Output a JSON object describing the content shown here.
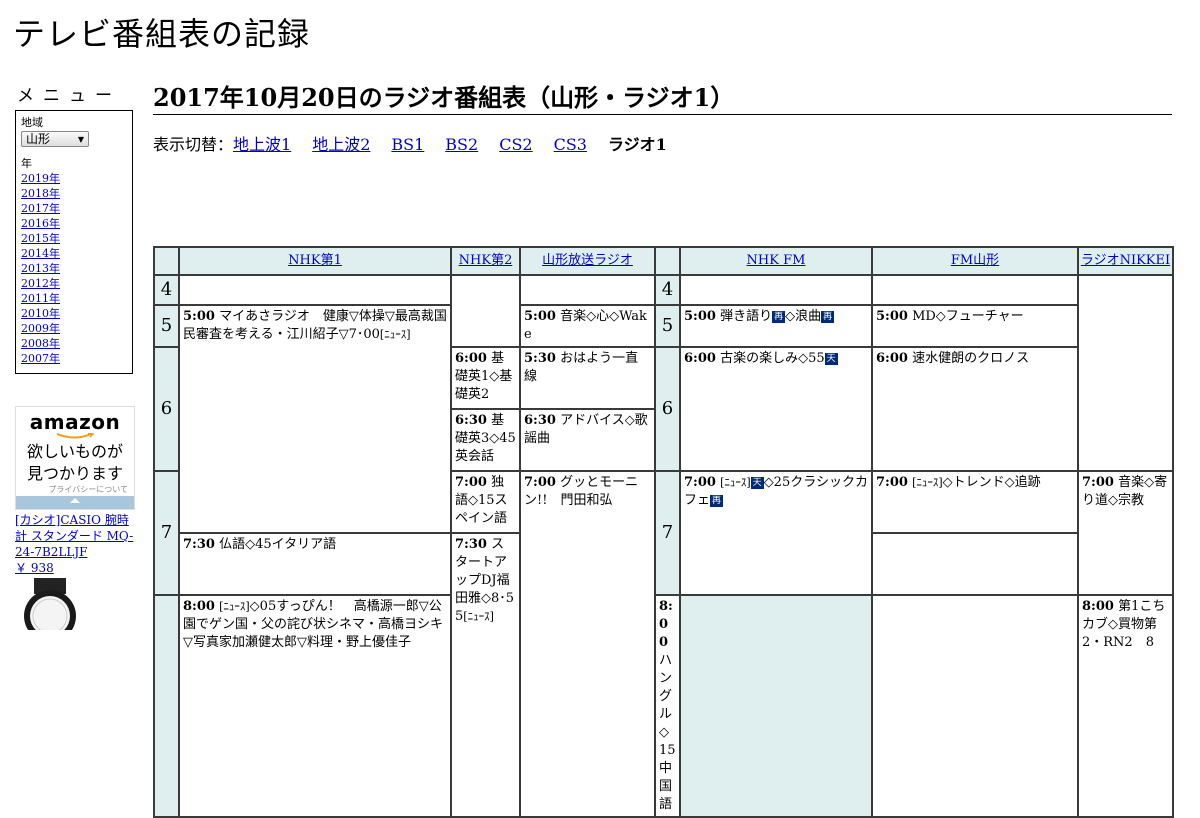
{
  "site": {
    "title": "テレビ番組表の記録"
  },
  "sidebar": {
    "heading": "メニュー",
    "region_label": "地域",
    "region_value": "山形",
    "year_label": "年",
    "years": [
      "2019年",
      "2018年",
      "2017年",
      "2016年",
      "2015年",
      "2014年",
      "2013年",
      "2012年",
      "2011年",
      "2010年",
      "2009年",
      "2008年",
      "2007年"
    ]
  },
  "ad": {
    "logo": "amazon",
    "line1": "欲しいものが",
    "line2": "見つかります",
    "privacy": "プライバシーについて",
    "product_title": "[カシオ]CASIO 腕時計 スタンダード MQ-24-7B2LLJF",
    "price": "￥ 938"
  },
  "page": {
    "heading": "2017年10月20日のラジオ番組表（山形・ラジオ1）",
    "switch_label": "表示切替：",
    "switch_links": [
      "地上波1",
      "地上波2",
      "BS1",
      "BS2",
      "CS2",
      "CS3"
    ],
    "switch_current": "ラジオ1"
  },
  "grid": {
    "stations": [
      "NHK第1",
      "NHK第2",
      "山形放送ラジオ",
      "NHK FM",
      "FM山形",
      "ラジオNIKKEI"
    ],
    "hours": [
      "4",
      "5",
      "6",
      "7"
    ],
    "programs": {
      "nhk1_500": {
        "time": "5:00",
        "title": "マイあさラジオ　健康▽体操▽最高裁国民審査を考える・江川紹子▽7･00",
        "mark": "[ﾆｭｰｽ]"
      },
      "nhk1_800": {
        "time": "8:00",
        "mark": "[ﾆｭｰｽ]",
        "title": "◇05すっぴん！　高橋源一郎▽公園でゲン国・父の詫び状シネマ・高橋ヨシキ▽写真家加瀬健太郎▽料理・野上優佳子"
      },
      "nhk2_600": {
        "time": "6:00",
        "title": "基礎英1◇基礎英2"
      },
      "nhk2_630": {
        "time": "6:30",
        "title": "基礎英3◇45英会話"
      },
      "nhk2_700": {
        "time": "7:00",
        "title": "独語◇15スペイン語"
      },
      "nhk2_730": {
        "time": "7:30",
        "title": "仏語◇45イタリア語"
      },
      "nhk2_800": {
        "time": "8:00",
        "title": "ハングル◇15中国語"
      },
      "ybc_500": {
        "time": "5:00",
        "title": "音楽◇心◇Wake"
      },
      "ybc_530": {
        "time": "5:30",
        "title": "おはよう一直線"
      },
      "ybc_630": {
        "time": "6:30",
        "title": "アドバイス◇歌謡曲"
      },
      "ybc_700": {
        "time": "7:00",
        "title": "グッとモーニン!!　門田和弘"
      },
      "nhkfm_500": {
        "time": "5:00",
        "title": "弾き語り",
        "mark1": "再",
        "title2": "◇浪曲",
        "mark2": "再"
      },
      "nhkfm_600": {
        "time": "6:00",
        "title": "古楽の楽しみ◇55",
        "mark": "天"
      },
      "nhkfm_700": {
        "time": "7:00",
        "mark1": "[ﾆｭｰｽ]",
        "mark2": "天",
        "title": "◇25クラシックカフェ",
        "mark3": "再"
      },
      "fmy_500": {
        "time": "5:00",
        "title": "MD◇フューチャー"
      },
      "fmy_600": {
        "time": "6:00",
        "title": "速水健朗のクロノス"
      },
      "fmy_700": {
        "time": "7:00",
        "mark": "[ﾆｭｰｽ]",
        "title": "◇トレンド◇追跡"
      },
      "fmy_730": {
        "time": "7:30",
        "title": "スタートアップDJ福田雅◇8･55",
        "mark": "[ﾆｭｰｽ]"
      },
      "nikkei_700": {
        "time": "7:00",
        "title": "音楽◇寄り道◇宗教"
      },
      "nikkei_800": {
        "time": "8:00",
        "title": "第1こちカブ◇買物第2・RN2　8"
      }
    }
  },
  "colors": {
    "header_bg": "#dfeff0",
    "link": "#0000cc",
    "mark_dark": "#002b7a",
    "ad_bar": "#a9c7dc"
  }
}
